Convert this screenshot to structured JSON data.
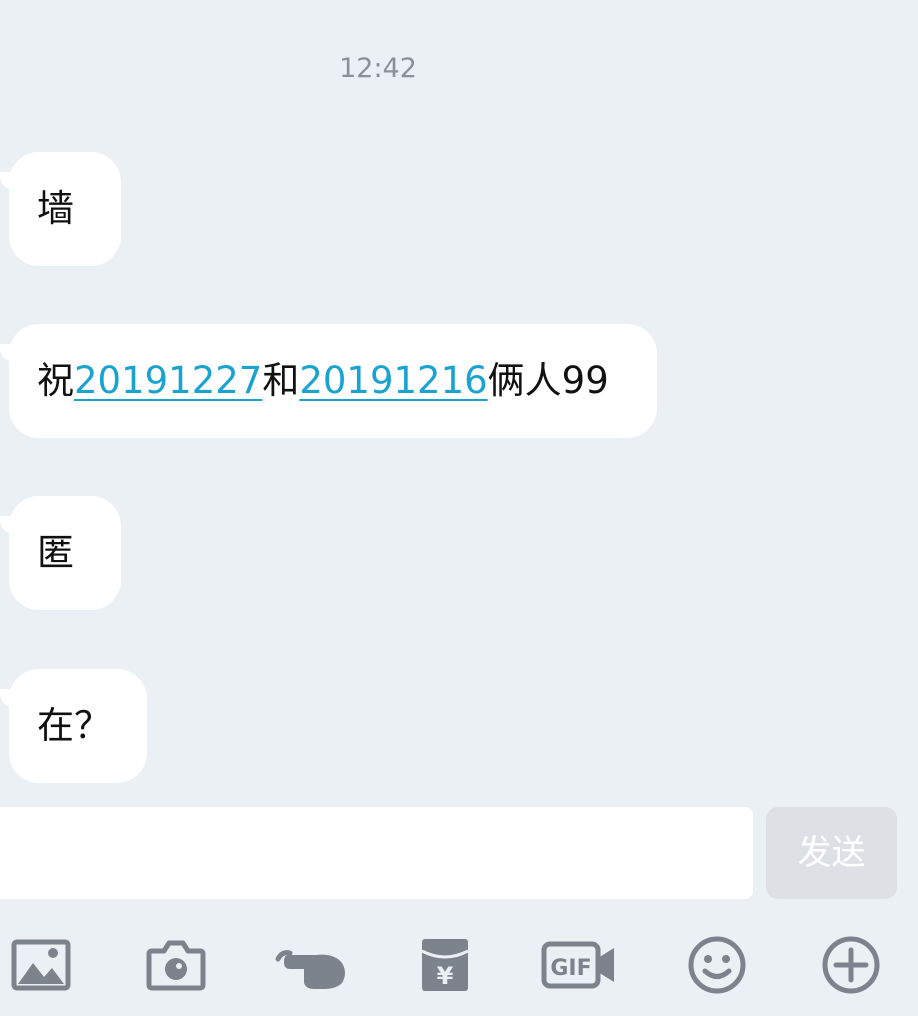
{
  "chat": {
    "timestamp": "12:42",
    "messages": [
      {
        "segments": [
          {
            "text": "墙",
            "link": false
          }
        ]
      },
      {
        "segments": [
          {
            "text": "祝",
            "link": false
          },
          {
            "text": "20191227",
            "link": true
          },
          {
            "text": "和",
            "link": false
          },
          {
            "text": "20191216",
            "link": true
          },
          {
            "text": "俩人99",
            "link": false
          }
        ]
      },
      {
        "segments": [
          {
            "text": "匿",
            "link": false
          }
        ]
      },
      {
        "segments": [
          {
            "text": "在？",
            "link": false
          }
        ]
      }
    ]
  },
  "composer": {
    "input_value": "",
    "send_label": "发送"
  },
  "toolbar": {
    "icons": [
      "image-icon",
      "camera-icon",
      "poke-icon",
      "red-packet-icon",
      "gif-icon",
      "emoji-icon",
      "plus-icon"
    ],
    "icon_color": "#7d838c",
    "gif_label": "GIF",
    "yuan_label": "¥"
  },
  "colors": {
    "background": "#ebf0f5",
    "link": "#1aa3cf",
    "send_disabled": "#dde1e6"
  }
}
